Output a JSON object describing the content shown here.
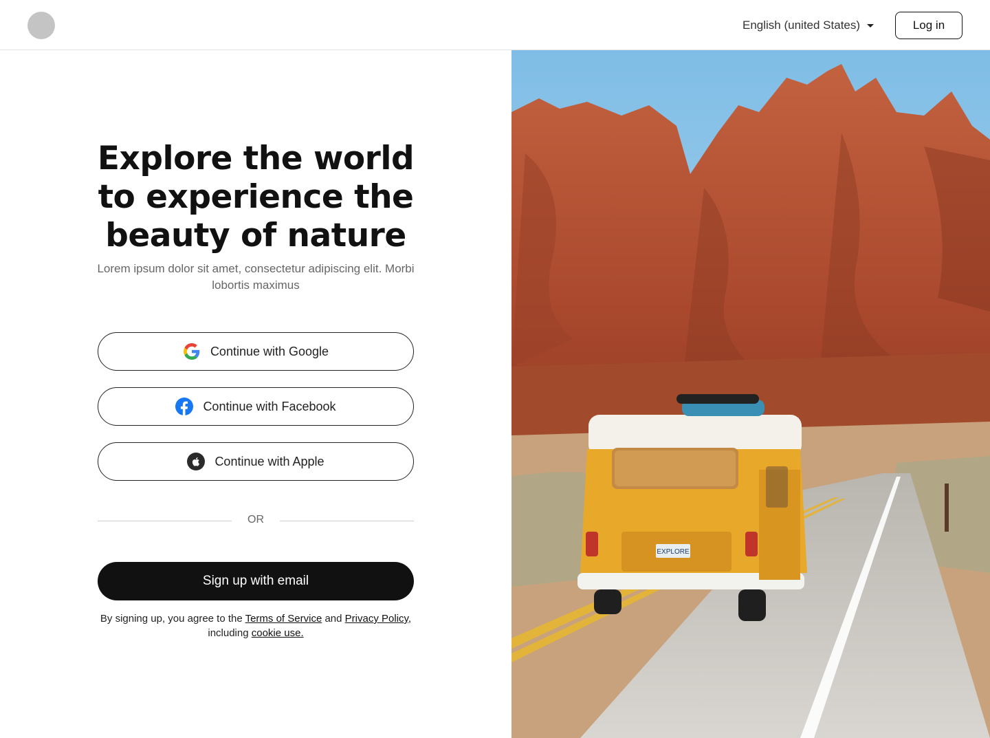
{
  "header": {
    "language": "English (united States)",
    "login_label": "Log in"
  },
  "main": {
    "title": "Explore the world to experience the beauty of nature",
    "subtitle": "Lorem ipsum dolor sit amet, consectetur adipiscing elit. Morbi lobortis maximus"
  },
  "auth": {
    "google_label": "Continue with Google",
    "facebook_label": "Continue with Facebook",
    "apple_label": "Continue with Apple",
    "or_label": "OR",
    "email_label": "Sign up with email"
  },
  "legal": {
    "prefix": "By signing up, you agree to the ",
    "terms_link": "Terms of Service",
    "and": " and ",
    "privacy_link": "Privacy Policy, ",
    "including": "including ",
    "cookie_link": "cookie use."
  },
  "hero": {
    "license_plate": "EXPLORE"
  },
  "colors": {
    "primary": "#111111",
    "van": "#e8a82a",
    "rock": "#b8563a",
    "sky": "#8ec5e8"
  }
}
